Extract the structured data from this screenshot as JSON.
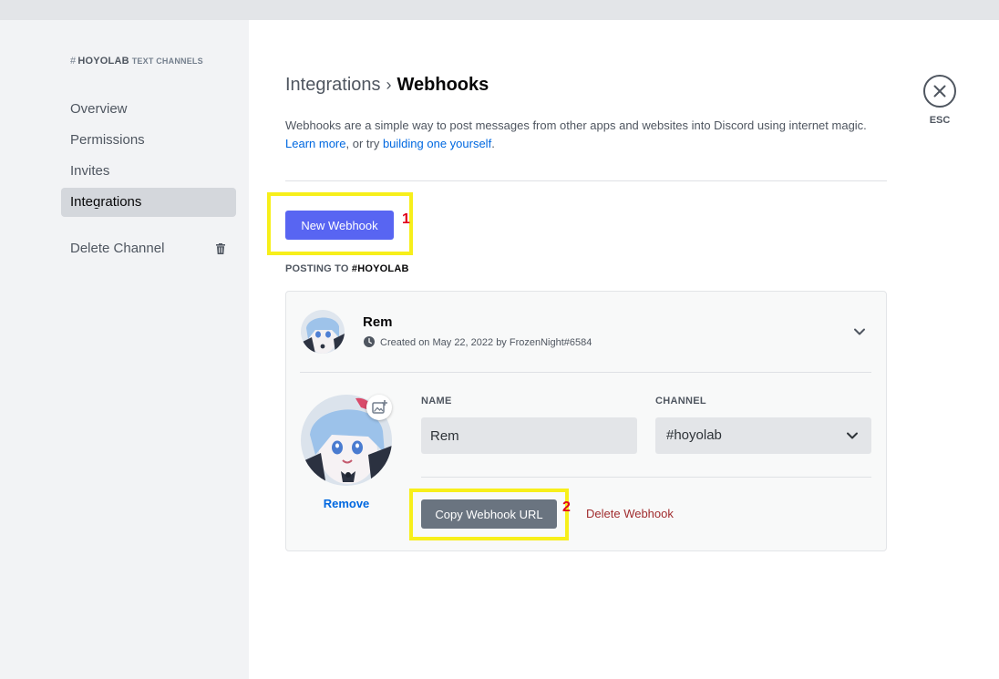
{
  "sidebar": {
    "header": {
      "channel": "HOYOLAB",
      "sub": "TEXT CHANNELS"
    },
    "items": [
      {
        "label": "Overview"
      },
      {
        "label": "Permissions"
      },
      {
        "label": "Invites"
      },
      {
        "label": "Integrations",
        "selected": true
      }
    ],
    "delete_label": "Delete Channel"
  },
  "main": {
    "breadcrumb": {
      "parent": "Integrations",
      "sep": "›",
      "current": "Webhooks"
    },
    "description": {
      "text": "Webhooks are a simple way to post messages from other apps and websites into Discord using internet magic.",
      "learn_more": "Learn more",
      "mid": ", or try ",
      "build": "building one yourself",
      "end": "."
    },
    "new_webhook_label": "New Webhook",
    "posting_prefix": "POSTING TO ",
    "posting_channel": "#HOYOLAB",
    "annotations": {
      "first": "1",
      "second": "2"
    }
  },
  "webhook": {
    "name": "Rem",
    "created": "Created on May 22, 2022 by FrozenNight#6584",
    "remove_label": "Remove",
    "name_label": "NAME",
    "name_value": "Rem",
    "channel_label": "CHANNEL",
    "channel_value": "#hoyolab",
    "copy_label": "Copy Webhook URL",
    "delete_label": "Delete Webhook"
  },
  "close": {
    "label": "ESC"
  },
  "colors": {
    "accent": "#5865f2",
    "highlight": "#f7ef1a",
    "danger": "#a12d2f",
    "link": "#0068e0"
  },
  "icons": [
    "hash-icon",
    "trash-icon",
    "clock-icon",
    "chevron-down-icon",
    "image-plus-icon",
    "close-icon"
  ]
}
